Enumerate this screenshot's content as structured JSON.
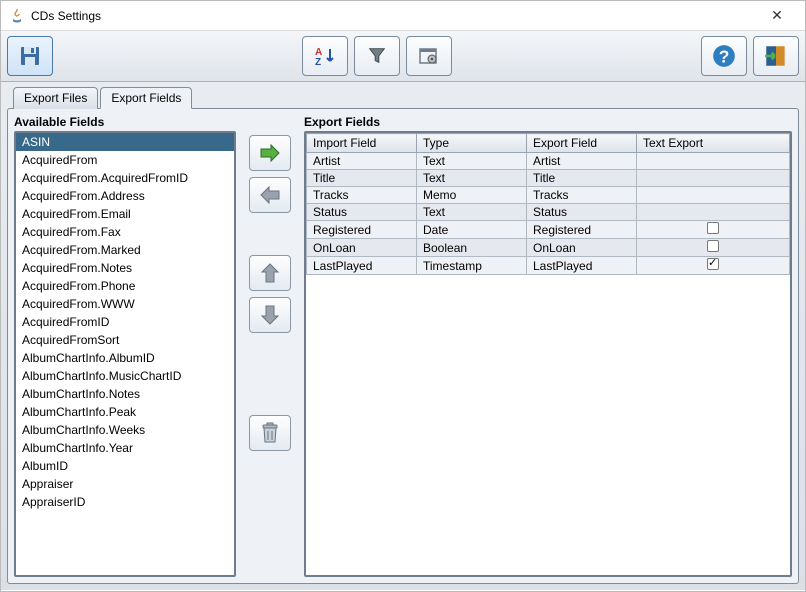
{
  "window": {
    "title": "CDs Settings"
  },
  "tabs": [
    {
      "label": "Export Files",
      "active": false
    },
    {
      "label": "Export Fields",
      "active": true
    }
  ],
  "sections": {
    "available_title": "Available Fields",
    "export_title": "Export Fields"
  },
  "available_fields": [
    {
      "label": "ASIN",
      "selected": true
    },
    {
      "label": "AcquiredFrom"
    },
    {
      "label": "AcquiredFrom.AcquiredFromID"
    },
    {
      "label": "AcquiredFrom.Address"
    },
    {
      "label": "AcquiredFrom.Email"
    },
    {
      "label": "AcquiredFrom.Fax"
    },
    {
      "label": "AcquiredFrom.Marked"
    },
    {
      "label": "AcquiredFrom.Notes"
    },
    {
      "label": "AcquiredFrom.Phone"
    },
    {
      "label": "AcquiredFrom.WWW"
    },
    {
      "label": "AcquiredFromID"
    },
    {
      "label": "AcquiredFromSort"
    },
    {
      "label": "AlbumChartInfo.AlbumID"
    },
    {
      "label": "AlbumChartInfo.MusicChartID"
    },
    {
      "label": "AlbumChartInfo.Notes"
    },
    {
      "label": "AlbumChartInfo.Peak"
    },
    {
      "label": "AlbumChartInfo.Weeks"
    },
    {
      "label": "AlbumChartInfo.Year"
    },
    {
      "label": "AlbumID"
    },
    {
      "label": "Appraiser"
    },
    {
      "label": "AppraiserID"
    }
  ],
  "export_table": {
    "columns": [
      "Import Field",
      "Type",
      "Export Field",
      "Text Export"
    ],
    "rows": [
      {
        "import": "Artist",
        "type": "Text",
        "export": "Artist",
        "text_export": null
      },
      {
        "import": "Title",
        "type": "Text",
        "export": "Title",
        "text_export": null
      },
      {
        "import": "Tracks",
        "type": "Memo",
        "export": "Tracks",
        "text_export": null
      },
      {
        "import": "Status",
        "type": "Text",
        "export": "Status",
        "text_export": null
      },
      {
        "import": "Registered",
        "type": "Date",
        "export": "Registered",
        "text_export": false
      },
      {
        "import": "OnLoan",
        "type": "Boolean",
        "export": "OnLoan",
        "text_export": false
      },
      {
        "import": "LastPlayed",
        "type": "Timestamp",
        "export": "LastPlayed",
        "text_export": true
      }
    ]
  }
}
